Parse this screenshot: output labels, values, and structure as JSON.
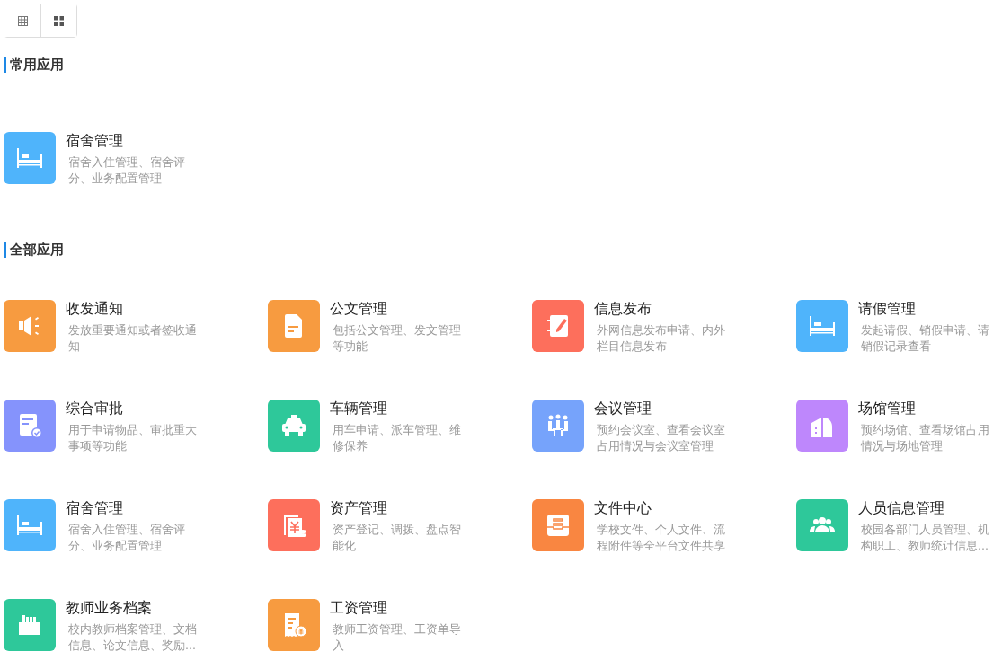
{
  "view_toggle": [
    {
      "kind": "table"
    },
    {
      "kind": "grid"
    }
  ],
  "sections": [
    {
      "title": "常用应用",
      "apps": [
        {
          "name": "宿舍管理",
          "description": "宿舍入住管理、宿舍评分、业务配置管理",
          "kind": "bed",
          "color": "#4fb4fb"
        }
      ]
    },
    {
      "title": "全部应用",
      "apps": [
        {
          "name": "收发通知",
          "description": "发放重要通知或者签收通知",
          "kind": "megaphone",
          "color": "#f79b40"
        },
        {
          "name": "公文管理",
          "description": "包括公文管理、发文管理等功能",
          "kind": "document",
          "color": "#f79b40"
        },
        {
          "name": "信息发布",
          "description": "外网信息发布申请、内外栏目信息发布",
          "kind": "notebook",
          "color": "#fd6f5c"
        },
        {
          "name": "请假管理",
          "description": "发起请假、销假申请、请销假记录查看",
          "kind": "bed",
          "color": "#4fb4fb"
        },
        {
          "name": "综合审批",
          "description": "用于申请物品、审批重大事项等功能",
          "kind": "approval",
          "color": "#8593fc"
        },
        {
          "name": "车辆管理",
          "description": "用车申请、派车管理、维修保养",
          "kind": "car",
          "color": "#2ec89a"
        },
        {
          "name": "会议管理",
          "description": "预约会议室、查看会议室占用情况与会议室管理",
          "kind": "meeting",
          "color": "#76a3fb"
        },
        {
          "name": "场馆管理",
          "description": "预约场馆、查看场馆占用情况与场地管理",
          "kind": "building",
          "color": "#be87fc"
        },
        {
          "name": "宿舍管理",
          "description": "宿舍入住管理、宿舍评分、业务配置管理",
          "kind": "bed",
          "color": "#4fb4fb"
        },
        {
          "name": "资产管理",
          "description": "资产登记、调拨、盘点智能化",
          "kind": "money",
          "color": "#fd6f5c"
        },
        {
          "name": "文件中心",
          "description": "学校文件、个人文件、流程附件等全平台文件共享",
          "kind": "inbox",
          "color": "#f98641"
        },
        {
          "name": "人员信息管理",
          "description": "校园各部门人员管理、机构职工、教师统计信息...",
          "kind": "people",
          "color": "#2ec89a"
        },
        {
          "name": "教师业务档案",
          "description": "校内教师档案管理、文档信息、论文信息、奖励...",
          "kind": "archive",
          "color": "#2ec89a"
        },
        {
          "name": "工资管理",
          "description": "教师工资管理、工资单导入",
          "kind": "salary",
          "color": "#f79b40"
        }
      ]
    }
  ]
}
